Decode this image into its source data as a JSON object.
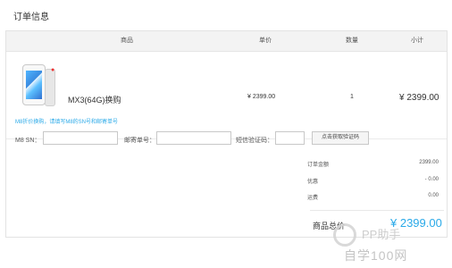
{
  "page": {
    "section_title": "订单信息"
  },
  "table": {
    "headers": {
      "product": "商品",
      "unit_price": "单价",
      "quantity": "数量",
      "subtotal": "小计"
    },
    "row": {
      "image_icon": "phone-product-image",
      "name": "MX3(64G)换购",
      "unit_price": "¥ 2399.00",
      "quantity": "1",
      "subtotal": "¥ 2399.00"
    }
  },
  "notice": "M8折价换购，请填写M8的SN号和邮寄单号",
  "form": {
    "sn_label": "M8 SN：",
    "sn_value": "",
    "tracking_label": "邮寄单号：",
    "tracking_value": "",
    "sms_label": "短信验证码：",
    "sms_value": "",
    "get_code_button": "点击获取验证码"
  },
  "summary": {
    "rows": [
      {
        "label": "订单金额",
        "value": "2399.00"
      },
      {
        "label": "优惠",
        "value": "- 0.00"
      },
      {
        "label": "运费",
        "value": "0.00"
      }
    ],
    "total_label": "商品总价",
    "total_value": "¥ 2399.00"
  },
  "watermark": {
    "top": "PP助手",
    "bottom": "自学100网"
  },
  "colors": {
    "accent": "#29a9e8",
    "header_bg": "#f3f3f3",
    "border": "#e3e3e3"
  }
}
